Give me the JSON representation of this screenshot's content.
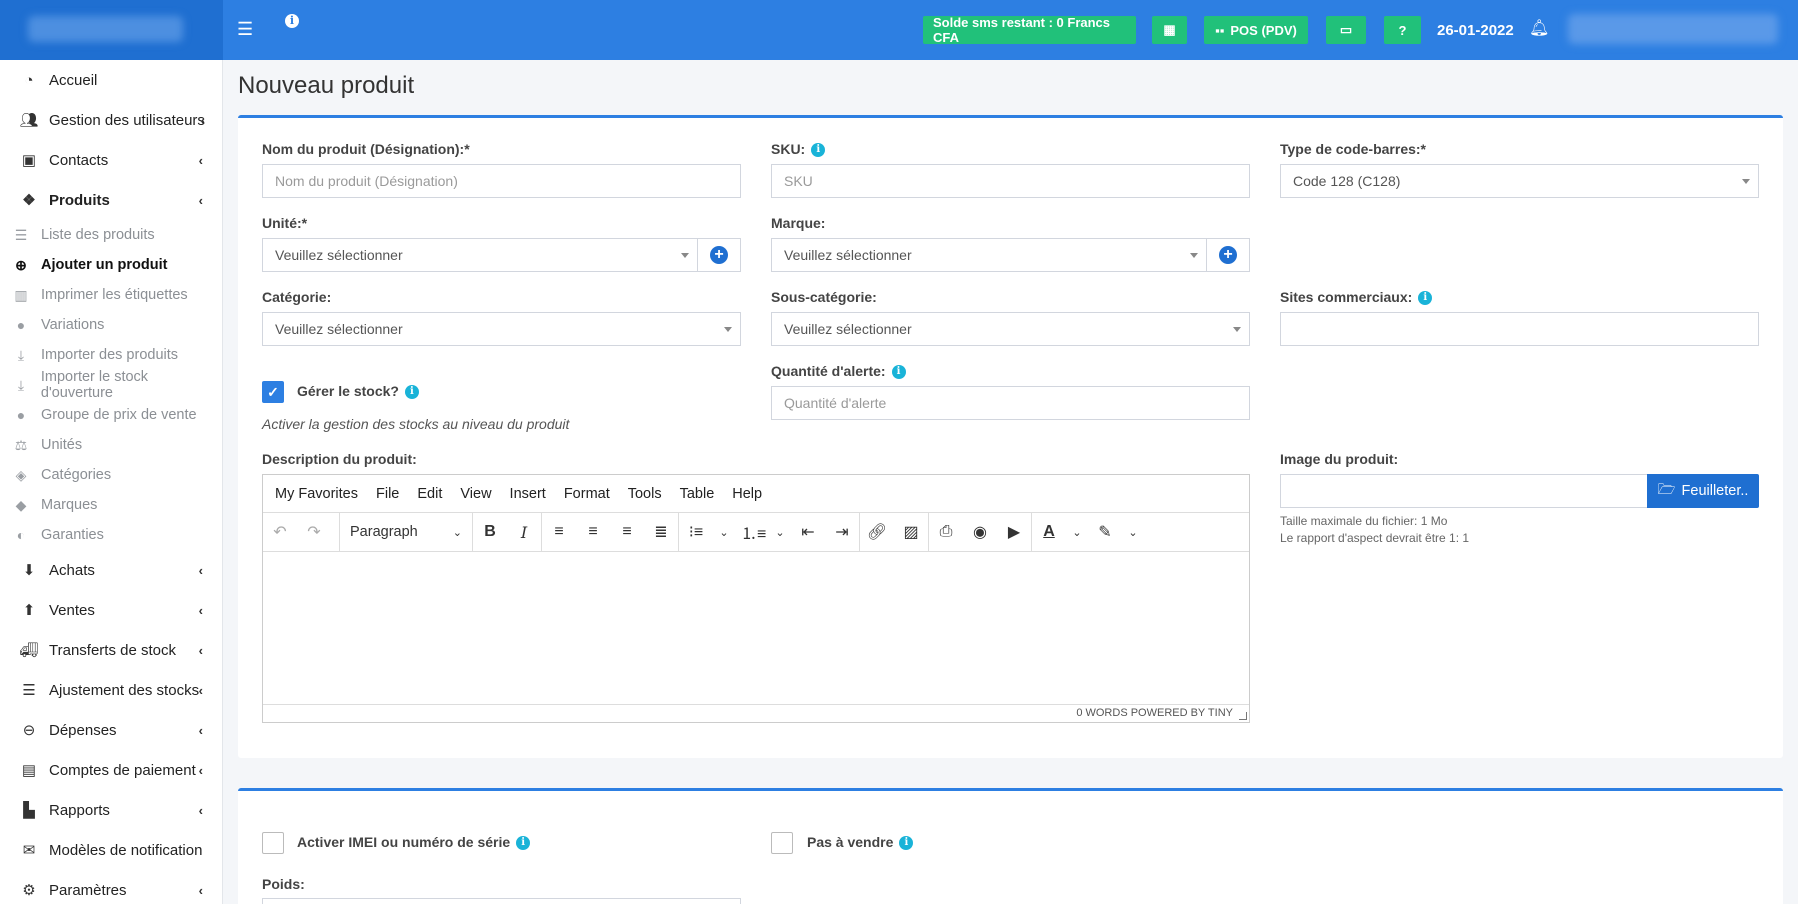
{
  "header": {
    "sms_balance": "Solde sms restant : 0 Francs CFA",
    "pos_label": "POS (PDV)",
    "date": "26-01-2022"
  },
  "sidebar": {
    "items": [
      {
        "label": "Accueil",
        "icon": "dashboard-icon"
      },
      {
        "label": "Gestion des utilisateurs",
        "icon": "users-icon"
      },
      {
        "label": "Contacts",
        "icon": "address-book-icon"
      },
      {
        "label": "Produits",
        "icon": "cubes-icon"
      },
      {
        "label": "Achats",
        "icon": "arrow-circle-down-icon"
      },
      {
        "label": "Ventes",
        "icon": "arrow-circle-up-icon"
      },
      {
        "label": "Transferts de stock",
        "icon": "truck-icon"
      },
      {
        "label": "Ajustement des stocks",
        "icon": "database-icon"
      },
      {
        "label": "Dépenses",
        "icon": "minus-circle-icon"
      },
      {
        "label": "Comptes de paiement",
        "icon": "money-check-icon"
      },
      {
        "label": "Rapports",
        "icon": "chart-icon"
      },
      {
        "label": "Modèles de notification",
        "icon": "envelope-icon"
      },
      {
        "label": "Paramètres",
        "icon": "cog-icon"
      }
    ],
    "products_sub": [
      {
        "label": "Liste des produits"
      },
      {
        "label": "Ajouter un produit"
      },
      {
        "label": "Imprimer les étiquettes"
      },
      {
        "label": "Variations"
      },
      {
        "label": "Importer des produits"
      },
      {
        "label": "Importer le stock d'ouverture"
      },
      {
        "label": "Groupe de prix de vente"
      },
      {
        "label": "Unités"
      },
      {
        "label": "Catégories"
      },
      {
        "label": "Marques"
      },
      {
        "label": "Garanties"
      }
    ]
  },
  "page": {
    "title": "Nouveau produit"
  },
  "form": {
    "name_label": "Nom du produit (Désignation):*",
    "name_placeholder": "Nom du produit (Désignation)",
    "sku_label": "SKU:",
    "sku_placeholder": "SKU",
    "barcode_label": "Type de code-barres:*",
    "barcode_value": "Code 128 (C128)",
    "unit_label": "Unité:*",
    "unit_value": "Veuillez sélectionner",
    "brand_label": "Marque:",
    "brand_value": "Veuillez sélectionner",
    "category_label": "Catégorie:",
    "category_value": "Veuillez sélectionner",
    "subcategory_label": "Sous-catégorie:",
    "subcategory_value": "Veuillez sélectionner",
    "sites_label": "Sites commerciaux:",
    "stock_label": "Gérer le stock?",
    "stock_help": "Activer la gestion des stocks au niveau du produit",
    "alert_label": "Quantité d'alerte:",
    "alert_placeholder": "Quantité d'alerte",
    "desc_label": "Description du produit:",
    "image_label": "Image du produit:",
    "browse_label": "Feuilleter..",
    "image_note1": "Taille maximale du fichier: 1 Mo",
    "image_note2": "Le rapport d'aspect devrait être 1: 1",
    "imei_label": "Activer IMEI ou numéro de série",
    "not_sale_label": "Pas à vendre",
    "weight_label": "Poids:"
  },
  "editor": {
    "menu": [
      "My Favorites",
      "File",
      "Edit",
      "View",
      "Insert",
      "Format",
      "Tools",
      "Table",
      "Help"
    ],
    "paragraph": "Paragraph",
    "status": "0 WORDS  POWERED BY TINY"
  }
}
